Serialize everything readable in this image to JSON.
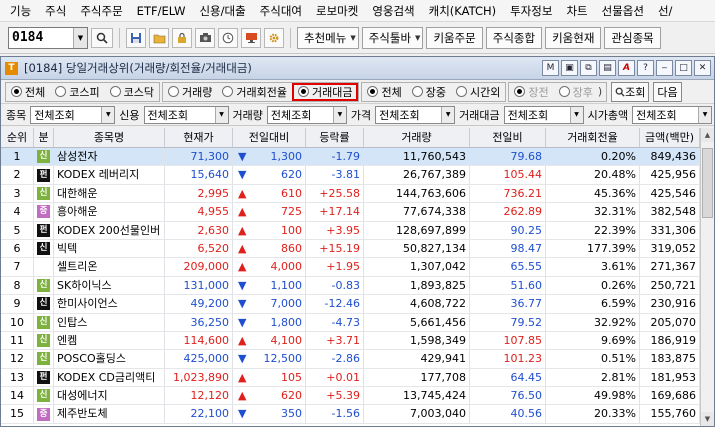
{
  "menu": [
    "기능",
    "주식",
    "주식주문",
    "ETF/ELW",
    "신용/대출",
    "주식대여",
    "로보마켓",
    "영웅검색",
    "캐치(KATCH)",
    "투자정보",
    "차트",
    "선물옵션",
    "선/"
  ],
  "toolbar": {
    "code": "0184",
    "buttons": [
      "추천메뉴",
      "주식툴바",
      "키움주문",
      "주식종합",
      "키움현재",
      "관심종목"
    ]
  },
  "window": {
    "title": "[0184] 당일거래상위(거래량/회전율/거래대금)",
    "buttons": [
      "M",
      "A",
      "?"
    ]
  },
  "filter1": {
    "market": [
      {
        "label": "전체",
        "on": true
      },
      {
        "label": "코스피",
        "on": false
      },
      {
        "label": "코스닥",
        "on": false
      }
    ],
    "sort": [
      {
        "label": "거래량",
        "on": false
      },
      {
        "label": "거래회전율",
        "on": false
      },
      {
        "label": "거래대금",
        "on": true
      }
    ],
    "session": [
      {
        "label": "전체",
        "on": true
      },
      {
        "label": "장중",
        "on": false
      },
      {
        "label": "시간외",
        "on": false
      }
    ],
    "sub": [
      {
        "label": "장전",
        "on": true
      },
      {
        "label": "장후",
        "on": false
      }
    ],
    "sub_close": ")",
    "query_label": "조회",
    "next_label": "다음"
  },
  "filter2": [
    {
      "label": "종목",
      "value": "전체조회"
    },
    {
      "label": "신용",
      "value": "전체조회"
    },
    {
      "label": "거래량",
      "value": "전체조회"
    },
    {
      "label": "가격",
      "value": "전체조회"
    },
    {
      "label": "거래대금",
      "value": "전체조회"
    },
    {
      "label": "시가총액",
      "value": "전체조회"
    }
  ],
  "columns": [
    "순위",
    "분",
    "종목명",
    "현재가",
    "전일대비",
    "등락률",
    "거래량",
    "전일비",
    "거래회전율",
    "금액(백만)"
  ],
  "rows": [
    {
      "rank": "1",
      "badge": "신",
      "btype": "shin",
      "name": "삼성전자",
      "price": "71,300",
      "dir": "dn",
      "chg": "1,300",
      "rate": "-1.79",
      "vol": "11,760,543",
      "ratio": "79.68",
      "ratio_dir": "dn",
      "turn": "0.20%",
      "amt": "849,436"
    },
    {
      "rank": "2",
      "badge": "펀",
      "btype": "pyeon",
      "name": "KODEX 레버리지",
      "price": "15,640",
      "dir": "dn",
      "chg": "620",
      "rate": "-3.81",
      "vol": "26,767,389",
      "ratio": "105.44",
      "ratio_dir": "up",
      "turn": "20.48%",
      "amt": "425,956"
    },
    {
      "rank": "3",
      "badge": "신",
      "btype": "shin",
      "name": "대한해운",
      "price": "2,995",
      "dir": "up",
      "chg": "610",
      "rate": "+25.58",
      "vol": "144,763,606",
      "ratio": "736.21",
      "ratio_dir": "up",
      "turn": "45.36%",
      "amt": "425,546"
    },
    {
      "rank": "4",
      "badge": "증",
      "btype": "jeung",
      "name": "흥아해운",
      "price": "4,955",
      "dir": "up",
      "chg": "725",
      "rate": "+17.14",
      "vol": "77,674,338",
      "ratio": "262.89",
      "ratio_dir": "up",
      "turn": "32.31%",
      "amt": "382,548"
    },
    {
      "rank": "5",
      "badge": "펀",
      "btype": "pyeon",
      "name": "KODEX 200선물인버",
      "price": "2,630",
      "dir": "up",
      "chg": "100",
      "rate": "+3.95",
      "vol": "128,697,899",
      "ratio": "90.25",
      "ratio_dir": "dn",
      "turn": "22.39%",
      "amt": "331,306"
    },
    {
      "rank": "6",
      "badge": "신",
      "btype": "shinb",
      "name": "빅텍",
      "price": "6,520",
      "dir": "up",
      "chg": "860",
      "rate": "+15.19",
      "vol": "50,827,134",
      "ratio": "98.47",
      "ratio_dir": "dn",
      "turn": "177.39%",
      "amt": "319,052"
    },
    {
      "rank": "7",
      "badge": "",
      "btype": "",
      "name": "셀트리온",
      "price": "209,000",
      "dir": "up",
      "chg": "4,000",
      "rate": "+1.95",
      "vol": "1,307,042",
      "ratio": "65.55",
      "ratio_dir": "dn",
      "turn": "3.61%",
      "amt": "271,367"
    },
    {
      "rank": "8",
      "badge": "신",
      "btype": "shin",
      "name": "SK하이닉스",
      "price": "131,000",
      "dir": "dn",
      "chg": "1,100",
      "rate": "-0.83",
      "vol": "1,893,825",
      "ratio": "51.60",
      "ratio_dir": "dn",
      "turn": "0.26%",
      "amt": "250,721"
    },
    {
      "rank": "9",
      "badge": "신",
      "btype": "shinb",
      "name": "한미사이언스",
      "price": "49,200",
      "dir": "dn",
      "chg": "7,000",
      "rate": "-12.46",
      "vol": "4,608,722",
      "ratio": "36.77",
      "ratio_dir": "dn",
      "turn": "6.59%",
      "amt": "230,916"
    },
    {
      "rank": "10",
      "badge": "신",
      "btype": "shin",
      "name": "인탑스",
      "price": "36,250",
      "dir": "dn",
      "chg": "1,800",
      "rate": "-4.73",
      "vol": "5,661,456",
      "ratio": "79.52",
      "ratio_dir": "dn",
      "turn": "32.92%",
      "amt": "205,070"
    },
    {
      "rank": "11",
      "badge": "신",
      "btype": "shin",
      "name": "엔켐",
      "price": "114,600",
      "dir": "up",
      "chg": "4,100",
      "rate": "+3.71",
      "vol": "1,598,349",
      "ratio": "107.85",
      "ratio_dir": "up",
      "turn": "9.69%",
      "amt": "186,919"
    },
    {
      "rank": "12",
      "badge": "신",
      "btype": "shin",
      "name": "POSCO홀딩스",
      "price": "425,000",
      "dir": "dn",
      "chg": "12,500",
      "rate": "-2.86",
      "vol": "429,941",
      "ratio": "101.23",
      "ratio_dir": "up",
      "turn": "0.51%",
      "amt": "183,875"
    },
    {
      "rank": "13",
      "badge": "펀",
      "btype": "pyeon",
      "name": "KODEX CD금리액티",
      "price": "1,023,890",
      "dir": "up",
      "chg": "105",
      "rate": "+0.01",
      "vol": "177,708",
      "ratio": "64.45",
      "ratio_dir": "dn",
      "turn": "2.81%",
      "amt": "181,953"
    },
    {
      "rank": "14",
      "badge": "신",
      "btype": "shin",
      "name": "대성에너지",
      "price": "12,120",
      "dir": "up",
      "chg": "620",
      "rate": "+5.39",
      "vol": "13,745,424",
      "ratio": "76.50",
      "ratio_dir": "dn",
      "turn": "49.98%",
      "amt": "169,686"
    },
    {
      "rank": "15",
      "badge": "증",
      "btype": "jeung",
      "name": "제주반도체",
      "price": "22,100",
      "dir": "dn",
      "chg": "350",
      "rate": "-1.56",
      "vol": "7,003,040",
      "ratio": "40.56",
      "ratio_dir": "dn",
      "turn": "20.33%",
      "amt": "155,760"
    }
  ]
}
